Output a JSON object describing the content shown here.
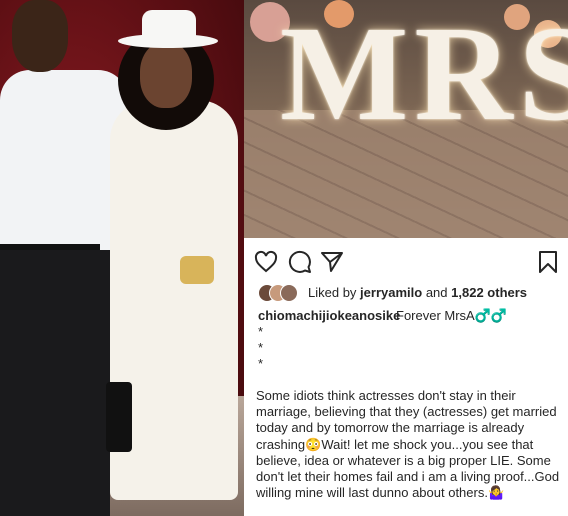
{
  "post": {
    "likes_prefix": "Liked by",
    "liked_by_user": "jerryamilo",
    "likes_conjunction": "and",
    "likes_count": "1,822 others",
    "author": "chiomachijiokeanosike",
    "caption_first_line": "Forever MrsA♂️♂️",
    "caption_stars": [
      "*",
      "*",
      "*"
    ],
    "caption_body": "Some idiots think actresses don't stay in their marriage, believing that they (actresses)  get married today and by tomorrow the marriage is already crashing😳Wait! let me shock you...you see that believe, idea or whatever is a big proper LIE. Some don't let their homes fail and i am a living proof...God willing mine will last dunno about others.🤷‍♀️"
  },
  "photo_right": {
    "sign_text": "MRS"
  },
  "icons": {
    "like": "heart-icon",
    "comment": "comment-icon",
    "share": "share-icon",
    "save": "bookmark-icon"
  },
  "colors": {
    "text": "#262626",
    "backdrop": "#7a141a"
  }
}
